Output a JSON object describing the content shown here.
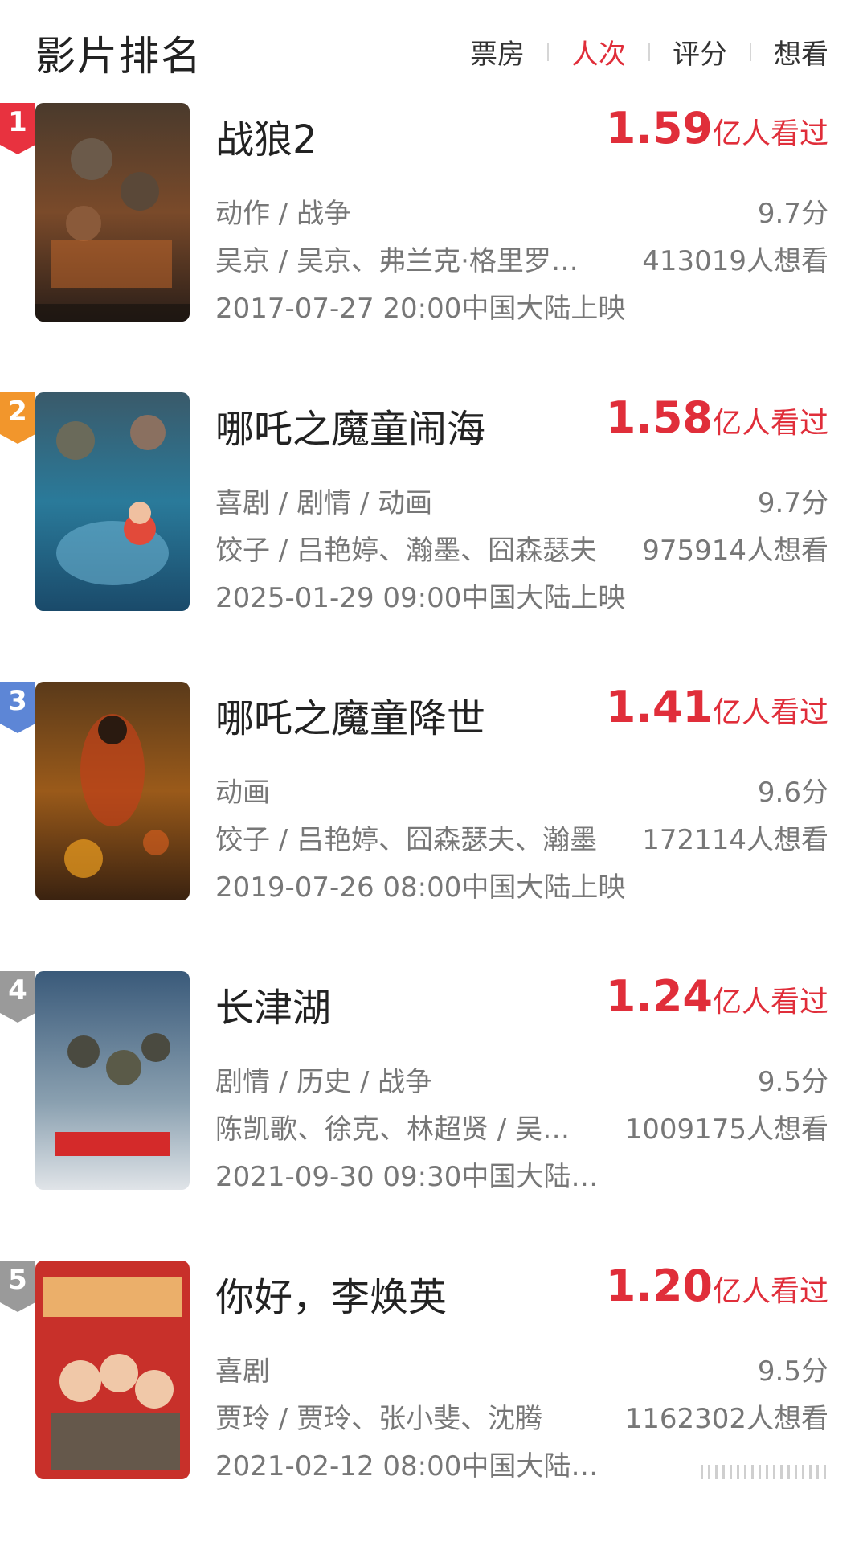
{
  "header": {
    "title": "影片排名",
    "tabs": [
      {
        "label": "票房",
        "active": false
      },
      {
        "label": "人次",
        "active": true
      },
      {
        "label": "评分",
        "active": false
      },
      {
        "label": "想看",
        "active": false
      }
    ]
  },
  "colors": {
    "accent": "#e02e3a",
    "rank1": "#e8323f",
    "rank2": "#f2962c",
    "rank3": "#5d86d6",
    "rank_other": "#9a9a9a"
  },
  "movies": [
    {
      "rank": "1",
      "title": "战狼2",
      "viewers_num": "1.59",
      "viewers_unit": "亿人看过",
      "genre": "动作 / 战争",
      "credits": "吴京 / 吴京、弗兰克·格里罗…",
      "release": "2017-07-27 20:00中国大陆上映",
      "score": "9.7分",
      "want": "413019人想看"
    },
    {
      "rank": "2",
      "title": "哪吒之魔童闹海",
      "viewers_num": "1.58",
      "viewers_unit": "亿人看过",
      "genre": "喜剧 / 剧情 / 动画",
      "credits": "饺子 / 吕艳婷、瀚墨、囧森瑟夫",
      "release": "2025-01-29 09:00中国大陆上映",
      "score": "9.7分",
      "want": "975914人想看"
    },
    {
      "rank": "3",
      "title": "哪吒之魔童降世",
      "viewers_num": "1.41",
      "viewers_unit": "亿人看过",
      "genre": "动画",
      "credits": "饺子 / 吕艳婷、囧森瑟夫、瀚墨",
      "release": "2019-07-26 08:00中国大陆上映",
      "score": "9.6分",
      "want": "172114人想看"
    },
    {
      "rank": "4",
      "title": "长津湖",
      "viewers_num": "1.24",
      "viewers_unit": "亿人看过",
      "genre": "剧情 / 历史 / 战争",
      "credits": "陈凯歌、徐克、林超贤 / 吴…",
      "release": "2021-09-30 09:30中国大陆…",
      "score": "9.5分",
      "want": "1009175人想看"
    },
    {
      "rank": "5",
      "title": "你好，李焕英",
      "viewers_num": "1.20",
      "viewers_unit": "亿人看过",
      "genre": "喜剧",
      "credits": "贾玲 / 贾玲、张小斐、沈腾",
      "release": "2021-02-12 08:00中国大陆…",
      "score": "9.5分",
      "want": "1162302人想看"
    }
  ]
}
